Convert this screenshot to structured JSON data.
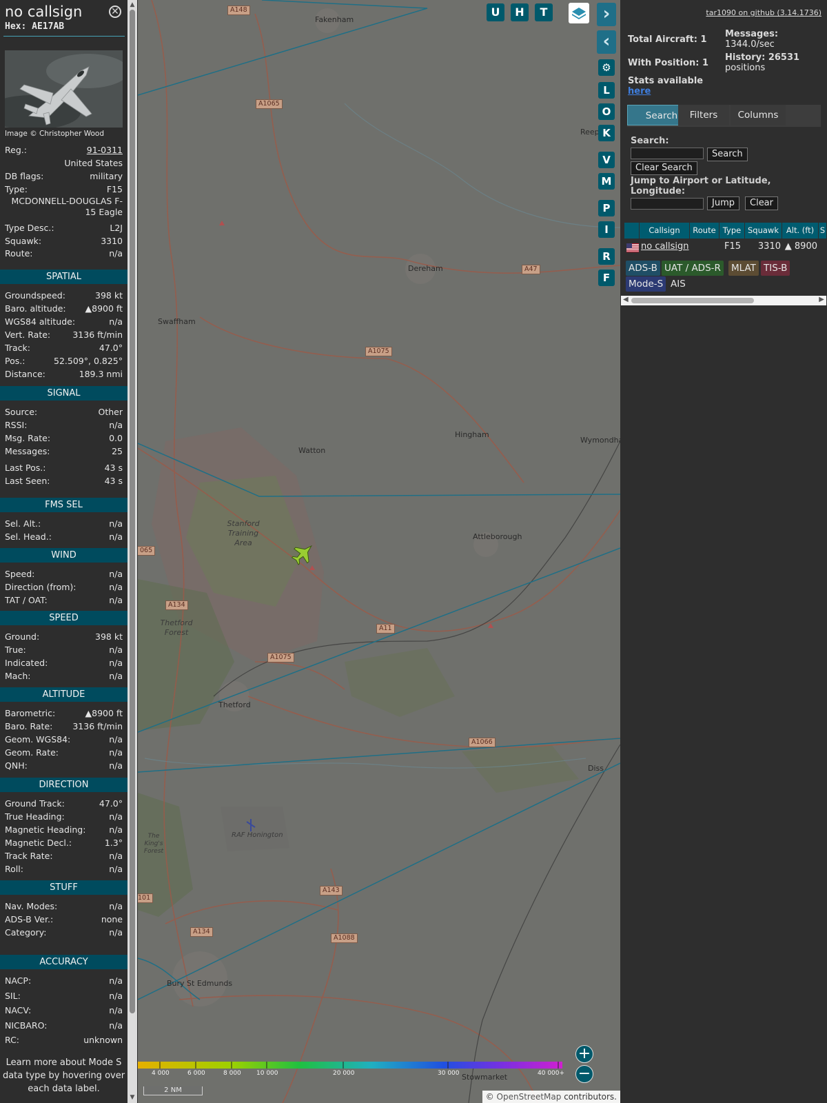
{
  "sidebar": {
    "callsign": "no callsign",
    "hex": "Hex: AE17AB",
    "photo_credit": "Image © Christopher Wood",
    "details": [
      {
        "k": "Reg.:",
        "v": "91-0311"
      },
      {
        "k": "",
        "v": "United States"
      },
      {
        "k": "DB flags:",
        "v": "military"
      },
      {
        "k": "Type:",
        "v": "F15"
      },
      {
        "k": "",
        "v": "MCDONNELL-DOUGLAS F-15 Eagle"
      },
      {
        "k": "Type Desc.:",
        "v": "L2J"
      },
      {
        "k": "Squawk:",
        "v": "3310"
      },
      {
        "k": "Route:",
        "v": "n/a"
      }
    ],
    "sections": [
      {
        "title": "SPATIAL",
        "rows": [
          {
            "k": "Groundspeed:",
            "v": "398 kt"
          },
          {
            "k": "Baro. altitude:",
            "v": "▲8900 ft"
          },
          {
            "k": "WGS84 altitude:",
            "v": "n/a"
          },
          {
            "k": "Vert. Rate:",
            "v": "3136 ft/min"
          },
          {
            "k": "Track:",
            "v": "47.0°"
          },
          {
            "k": "Pos.:",
            "v": "52.509°, 0.825°"
          },
          {
            "k": "Distance:",
            "v": "189.3 nmi"
          }
        ]
      },
      {
        "title": "SIGNAL",
        "rows": [
          {
            "k": "Source:",
            "v": "Other"
          },
          {
            "k": "RSSI:",
            "v": "n/a"
          },
          {
            "k": "Msg. Rate:",
            "v": "0.0"
          },
          {
            "k": "Messages:",
            "v": "25"
          },
          {
            "k": "Last Pos.:",
            "v": "43 s"
          },
          {
            "k": "Last Seen:",
            "v": "43 s"
          }
        ]
      },
      {
        "title": "FMS SEL",
        "rows": [
          {
            "k": "Sel. Alt.:",
            "v": "n/a"
          },
          {
            "k": "Sel. Head.:",
            "v": "n/a"
          }
        ]
      },
      {
        "title": "WIND",
        "rows": [
          {
            "k": "Speed:",
            "v": "n/a"
          },
          {
            "k": "Direction (from):",
            "v": "n/a"
          },
          {
            "k": "TAT / OAT:",
            "v": "n/a"
          }
        ]
      },
      {
        "title": "SPEED",
        "rows": [
          {
            "k": "Ground:",
            "v": "398 kt"
          },
          {
            "k": "True:",
            "v": "n/a"
          },
          {
            "k": "Indicated:",
            "v": "n/a"
          },
          {
            "k": "Mach:",
            "v": "n/a"
          }
        ]
      },
      {
        "title": "ALTITUDE",
        "rows": [
          {
            "k": "Barometric:",
            "v": "▲8900 ft"
          },
          {
            "k": "Baro. Rate:",
            "v": "3136 ft/min"
          },
          {
            "k": "Geom. WGS84:",
            "v": "n/a"
          },
          {
            "k": "Geom. Rate:",
            "v": "n/a"
          },
          {
            "k": "QNH:",
            "v": "n/a"
          }
        ]
      },
      {
        "title": "DIRECTION",
        "rows": [
          {
            "k": "Ground Track:",
            "v": "47.0°"
          },
          {
            "k": "True Heading:",
            "v": "n/a"
          },
          {
            "k": "Magnetic Heading:",
            "v": "n/a"
          },
          {
            "k": "Magnetic Decl.:",
            "v": "1.3°"
          },
          {
            "k": "Track Rate:",
            "v": "n/a"
          },
          {
            "k": "Roll:",
            "v": "n/a"
          }
        ]
      },
      {
        "title": "STUFF",
        "rows": [
          {
            "k": "Nav. Modes:",
            "v": "n/a"
          },
          {
            "k": "ADS-B Ver.:",
            "v": "none"
          },
          {
            "k": "Category:",
            "v": "n/a"
          }
        ]
      },
      {
        "title": "ACCURACY",
        "rows": [
          {
            "k": "NACP:",
            "v": "n/a"
          },
          {
            "k": "SIL:",
            "v": "n/a"
          },
          {
            "k": "NACV:",
            "v": "n/a"
          },
          {
            "k": "NICBARO:",
            "v": "n/a"
          },
          {
            "k": "RC:",
            "v": "unknown"
          }
        ]
      }
    ],
    "learn_more": "Learn more about Mode S data type by hovering over each data label."
  },
  "map": {
    "buttons_top": [
      "U",
      "H",
      "T"
    ],
    "side_buttons": [
      "L",
      "O",
      "K",
      "V",
      "M",
      "P",
      "I",
      "R",
      "F"
    ],
    "towns": [
      {
        "name": "Fakenham"
      },
      {
        "name": "Dereham"
      },
      {
        "name": "Swaffham"
      },
      {
        "name": "Hingham"
      },
      {
        "name": "Watton"
      },
      {
        "name": "Wymondha"
      },
      {
        "name": "Attleborough"
      },
      {
        "name": "Stanford Training Area"
      },
      {
        "name": "Thetford Forest"
      },
      {
        "name": "Thetford"
      },
      {
        "name": "Diss"
      },
      {
        "name": "RAF Honington"
      },
      {
        "name": "The King's Forest"
      },
      {
        "name": "Bury St Edmunds"
      },
      {
        "name": "Stowmarket"
      },
      {
        "name": "Reep"
      }
    ],
    "roads": [
      "A148",
      "A1065",
      "A47",
      "A1075",
      "065",
      "A134",
      "A11",
      "A1075",
      "A1066",
      "A143",
      "101",
      "A134",
      "A1088"
    ],
    "altitude_scale": [
      "4 000",
      "6 000",
      "8 000",
      "10 000",
      "20 000",
      "30 000",
      "40 000+"
    ],
    "scale_label": "2 NM",
    "attribution_prefix": "© ",
    "attribution_link": "OpenStreetMap",
    "attribution_suffix": " contributors."
  },
  "panel": {
    "github_link": "tar1090 on github (3.14.1736)",
    "total_aircraft": "Total Aircraft: 1",
    "with_position": "With Position: 1",
    "messages_label": "Messages:",
    "messages_value": "1344.0/sec",
    "history_label": "History: 26531",
    "history_value": "positions",
    "stats_label": "Stats available",
    "stats_link": "here",
    "tabs": [
      "Search",
      "Filters",
      "Columns"
    ],
    "search_label": "Search:",
    "search_button": "Search",
    "clear_search_button": "Clear Search",
    "jump_label": "Jump to Airport or Latitude, Longitude:",
    "jump_button": "Jump",
    "clear_button": "Clear",
    "table": {
      "headers": [
        "Callsign",
        "Route",
        "Type",
        "Squawk",
        "Alt. (ft)",
        "S"
      ],
      "row": {
        "callsign": "no callsign",
        "route": "",
        "type": "F15",
        "squawk": "3310",
        "alt": "▲ 8900"
      }
    },
    "source_badges": [
      {
        "label": "ADS-B",
        "color": "#1f4e66"
      },
      {
        "label": "UAT / ADS-R",
        "color": "#2b5a2b"
      },
      {
        "label": "MLAT",
        "color": "#5c4c33"
      },
      {
        "label": "TIS-B",
        "color": "#6a2c39"
      },
      {
        "label": "Mode-S",
        "color": "#2c3a73"
      },
      {
        "label": "AIS",
        "color": "#2e2e2e"
      }
    ]
  }
}
